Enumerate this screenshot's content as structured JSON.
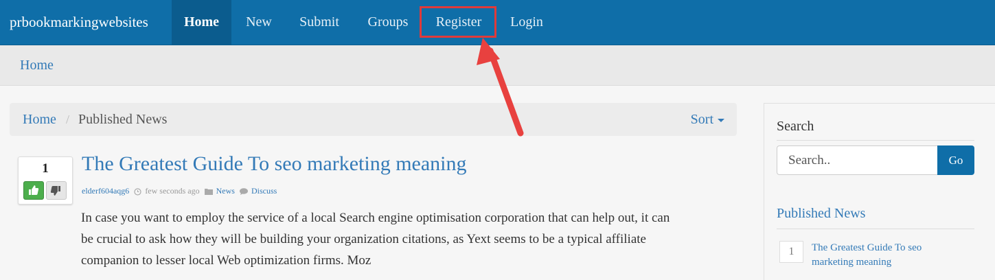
{
  "navbar": {
    "brand": "prbookmarkingwebsites",
    "items": [
      {
        "label": "Home"
      },
      {
        "label": "New"
      },
      {
        "label": "Submit"
      },
      {
        "label": "Groups"
      },
      {
        "label": "Register"
      },
      {
        "label": "Login"
      }
    ]
  },
  "subbar": {
    "home_label": "Home"
  },
  "breadcrumb": {
    "home": "Home",
    "separator": "/",
    "current": "Published News",
    "sort_label": "Sort"
  },
  "story": {
    "votes": "1",
    "title": "The Greatest Guide To seo marketing meaning",
    "author": "elderf604aqg6",
    "time": "few seconds ago",
    "category": "News",
    "discuss": "Discuss",
    "text": "In case you want to employ the service of a local Search engine optimisation corporation that can help out, it can be crucial to ask how they will be building your organization citations, as Yext seems to be a typical affiliate companion to lesser local Web optimization firms. Moz"
  },
  "sidebar": {
    "search_title": "Search",
    "search_placeholder": "Search..",
    "go_label": "Go",
    "news_title": "Published News",
    "news_items": [
      {
        "rank": "1",
        "title": "The Greatest Guide To seo marketing meaning"
      }
    ]
  },
  "colors": {
    "navbar": "#0f6ea8",
    "link": "#337ab7",
    "highlight": "#e03a3a",
    "upvote": "#4cae4c"
  }
}
